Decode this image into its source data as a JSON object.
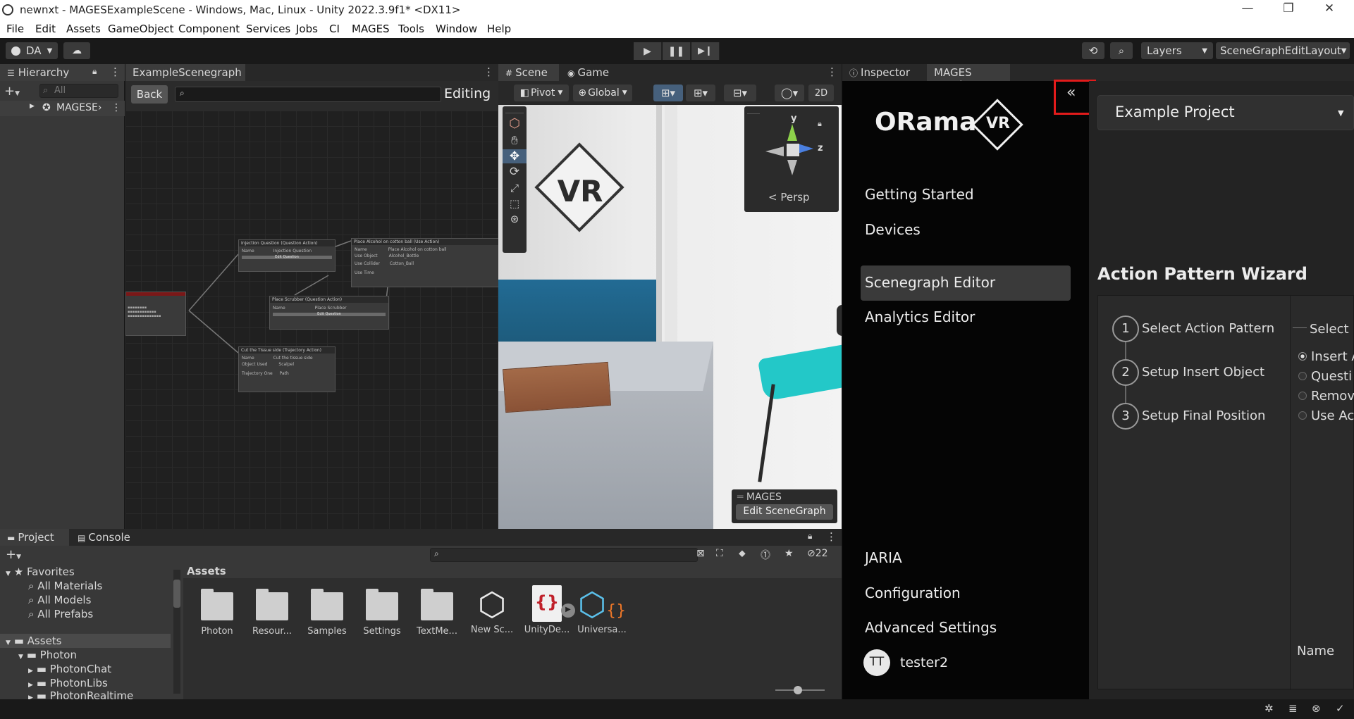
{
  "window": {
    "title": "newnxt - MAGESExampleScene - Windows, Mac, Linux - Unity 2022.3.9f1* <DX11>",
    "minimize": "—",
    "maximize": "❐",
    "close": "✕"
  },
  "menu": [
    "File",
    "Edit",
    "Assets",
    "GameObject",
    "Component",
    "Services",
    "Jobs",
    "CI",
    "MAGES",
    "Tools",
    "Window",
    "Help"
  ],
  "toolbar": {
    "account": "DA",
    "layers": "Layers",
    "layout": "SceneGraphEditLayout"
  },
  "hierarchy": {
    "tab": "Hierarchy",
    "search_placeholder": "All",
    "root_item": "MAGESE›"
  },
  "scenegraph": {
    "tab": "ExampleScenegraph",
    "back": "Back",
    "mode": "Editing",
    "nodes": [
      {
        "title": "Injection Question (Question Action)",
        "label": "Name",
        "value": "Injection Question",
        "button": "Edit Question"
      },
      {
        "title": "Place Alcohol on cotton ball (Use Action)",
        "label": "Name",
        "value": "Place Alcohol on cotton ball",
        "field1": "Use Object",
        "field1_val": "Alcohol_Bottle",
        "field2": "Use Collider",
        "field2_val": "Cotton_Ball",
        "field3": "Use Time"
      },
      {
        "title": "Place Scrubber (Question Action)",
        "label": "Name",
        "value": "Place Scrubber",
        "button": "Edit Question"
      },
      {
        "title": "Cut the Tissue side (Trajectory Action)",
        "label": "Name",
        "value": "Cut the tissue side",
        "field1": "Object Used",
        "field1_val": "Scalpel",
        "field2": "Trajectory One",
        "field2_val": "Path"
      }
    ]
  },
  "scene": {
    "tab_scene": "Scene",
    "tab_game": "Game",
    "pivot": "Pivot",
    "global": "Global",
    "mode2d": "2D",
    "persp": "< Persp",
    "gizmo_y": "y",
    "gizmo_z": "z",
    "overlay_title": "MAGES",
    "overlay_button": "Edit SceneGraph",
    "sign_text": "VR"
  },
  "inspector": {
    "tab_inspector": "Inspector",
    "tab_mages": "MAGES Panel",
    "logo_text": "ORama",
    "logo_badge": "VR",
    "nav": [
      "Getting Started",
      "Devices",
      "Scenegraph Editor",
      "Analytics Editor"
    ],
    "nav_bottom": [
      "JARIA",
      "Configuration",
      "Advanced Settings"
    ],
    "user_initials": "TT",
    "user_name": "tester2",
    "project_select": "Example Project",
    "wizard_title": "Action Pattern Wizard",
    "steps": [
      {
        "num": "1",
        "label": "Select Action Pattern"
      },
      {
        "num": "2",
        "label": "Setup Insert Object"
      },
      {
        "num": "3",
        "label": "Setup Final Position"
      }
    ],
    "select_heading": "Select",
    "options": [
      "Insert A",
      "Questi",
      "Remov",
      "Use Ac"
    ],
    "name_label": "Name"
  },
  "project": {
    "tab_project": "Project",
    "tab_console": "Console",
    "hidden_count": "22",
    "favorites": "Favorites",
    "fav_items": [
      "All Materials",
      "All Models",
      "All Prefabs"
    ],
    "assets_root": "Assets",
    "tree": [
      "Photon",
      "PhotonChat",
      "PhotonLibs",
      "PhotonRealtime"
    ],
    "breadcrumb": "Assets",
    "assets": [
      "Photon",
      "Resour...",
      "Samples",
      "Settings",
      "TextMe...",
      "New Sc...",
      "UnityDe...",
      "Universa..."
    ]
  }
}
